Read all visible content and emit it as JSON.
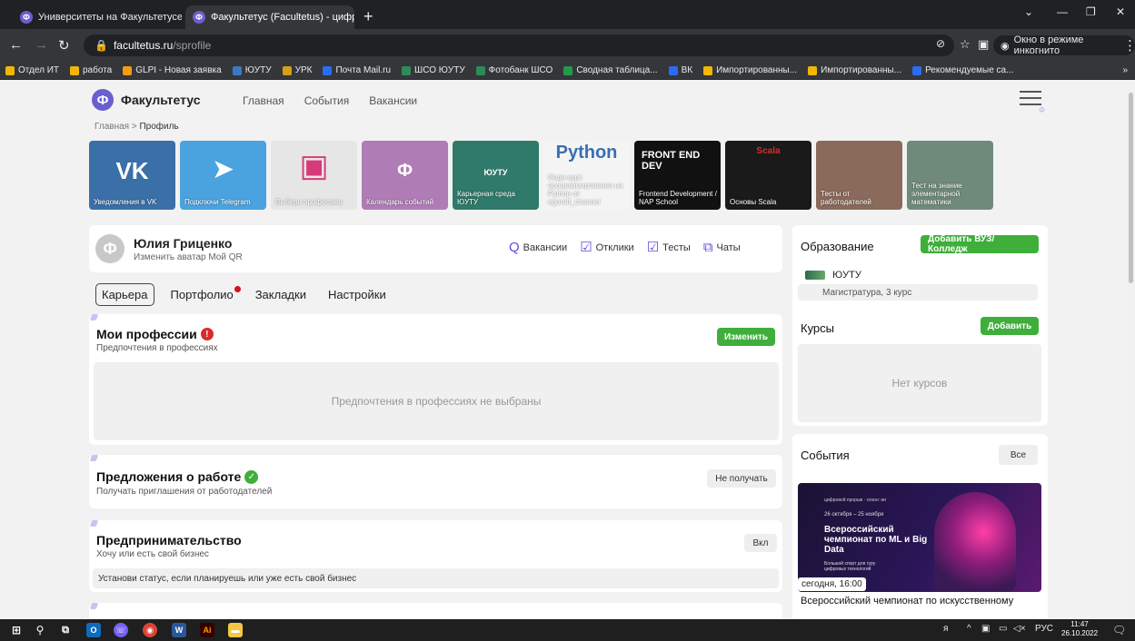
{
  "browser": {
    "tabs": [
      {
        "title": "Университеты на Факультетусе",
        "favicon": "Ф"
      },
      {
        "title": "Факультетус (Facultetus) - цифр",
        "favicon": "Ф"
      }
    ],
    "new_tab": "+",
    "url_host": "facultetus.ru",
    "url_path": "/sprofile",
    "incognito": "Окно в режиме инкогнито",
    "bookmarks": [
      {
        "label": "Отдел ИТ",
        "color": "#f2b705"
      },
      {
        "label": "работа",
        "color": "#f2b705"
      },
      {
        "label": "GLPI - Новая заявка",
        "color": "#f39c12"
      },
      {
        "label": "ЮУТУ",
        "color": "#3a78c4"
      },
      {
        "label": "УРК",
        "color": "#d4a017"
      },
      {
        "label": "Почта Mail.ru",
        "color": "#2a6df4"
      },
      {
        "label": "ШСО ЮУТУ",
        "color": "#2e8b57"
      },
      {
        "label": "Фотобанк ШСО",
        "color": "#2e8b57"
      },
      {
        "label": "Сводная таблица...",
        "color": "#1e9c4a"
      },
      {
        "label": "ВК",
        "color": "#2a6df4"
      },
      {
        "label": "Импортированны...",
        "color": "#f2b705"
      },
      {
        "label": "Импортированны...",
        "color": "#f2b705"
      },
      {
        "label": "Рекомендуемые са...",
        "color": "#2a6df4"
      }
    ],
    "bookmarks_more": "»"
  },
  "site": {
    "brand": "Факультетус",
    "brand_mark": "Ф",
    "nav": [
      "Главная",
      "События",
      "Вакансии"
    ],
    "breadcrumb_home": "Главная",
    "breadcrumb_sep": ">",
    "breadcrumb_current": "Профиль"
  },
  "stories": [
    {
      "caption": "Уведомления в VK",
      "icon": "vk-icon",
      "glyph": "VK",
      "color": "#3a6fa8"
    },
    {
      "caption": "Подключи Telegram",
      "icon": "telegram-icon",
      "glyph": "➤",
      "color": "#4aa3df"
    },
    {
      "caption": "Выбери профессию",
      "icon": "briefcase-icon",
      "glyph": "▣",
      "color": "#e6e6e6"
    },
    {
      "caption": "Календарь событий",
      "icon": "calendar-icon",
      "glyph": "Ф",
      "color": "#b07cb6"
    },
    {
      "caption": "Карьерная среда ЮУТУ",
      "icon": "university-icon",
      "glyph": "ЮУТУ",
      "color": "#2f7a6a"
    },
    {
      "caption": "Инди-курс программирования на Python от egoroff_channel",
      "icon": "python-icon",
      "glyph": "Python",
      "color": "#f4f4f4"
    },
    {
      "caption": "Frontend Development / NAP School",
      "icon": "frontend-icon",
      "glyph": "FRONT END DEV",
      "color": "#111111"
    },
    {
      "caption": "Основы Scala",
      "icon": "scala-icon",
      "glyph": "Scala",
      "color": "#1a1a1a"
    },
    {
      "caption": "Тесты от работодателей",
      "icon": "tests-photo",
      "glyph": "",
      "color": "#8a6a5a"
    },
    {
      "caption": "Тест на знание элементарной математики",
      "icon": "math-painting",
      "glyph": "",
      "color": "#6f8a7a"
    }
  ],
  "profile": {
    "avatar": "Ф",
    "name": "Юлия Гриценко",
    "sub": "Изменить аватар Мой QR",
    "quick_links": [
      {
        "label": "Вакансии",
        "icon": "search-icon",
        "glyph": "Q"
      },
      {
        "label": "Отклики",
        "icon": "response-icon",
        "glyph": "☑"
      },
      {
        "label": "Тесты",
        "icon": "tests-icon",
        "glyph": "☑"
      },
      {
        "label": "Чаты",
        "icon": "chat-icon",
        "glyph": "⧉"
      }
    ],
    "tabs": [
      "Карьера",
      "Портфолио",
      "Закладки",
      "Настройки"
    ]
  },
  "sections": {
    "professions": {
      "title": "Мои профессии",
      "sub": "Предпочтения в профессиях",
      "button": "Изменить",
      "empty": "Предпочтения в профессиях не выбраны",
      "badge": "!"
    },
    "offers": {
      "title": "Предложения о работе",
      "sub": "Получать приглашения от работодателей",
      "button": "Не получать",
      "badge": "✓"
    },
    "business": {
      "title": "Предпринимательство",
      "sub": "Хочу или есть свой бизнес",
      "button": "Вкл",
      "hint": "Установи статус, если планируешь или уже есть свой бизнес"
    }
  },
  "sidebar": {
    "education": {
      "title": "Образование",
      "button": "Добавить ВУЗ/Колледж",
      "university": "ЮУТУ",
      "degree": "Магистратура, 3 курс"
    },
    "courses": {
      "title": "Курсы",
      "button": "Добавить",
      "empty": "Нет курсов"
    },
    "events": {
      "title": "События",
      "button": "Все",
      "banner_top": "цифровой прорыв · сезон: ии",
      "banner_dates": "26 октября – 25 ноября",
      "banner_title": "Всероссийский чемпионат по ML и Big Data",
      "banner_tagline": "Большой спорт для гуру цифровых технологий",
      "time": "сегодня, 16:00",
      "name": "Всероссийский чемпионат по искусственному"
    }
  },
  "taskbar": {
    "lang": "РУС",
    "time": "11:47",
    "date": "26.10.2022"
  }
}
